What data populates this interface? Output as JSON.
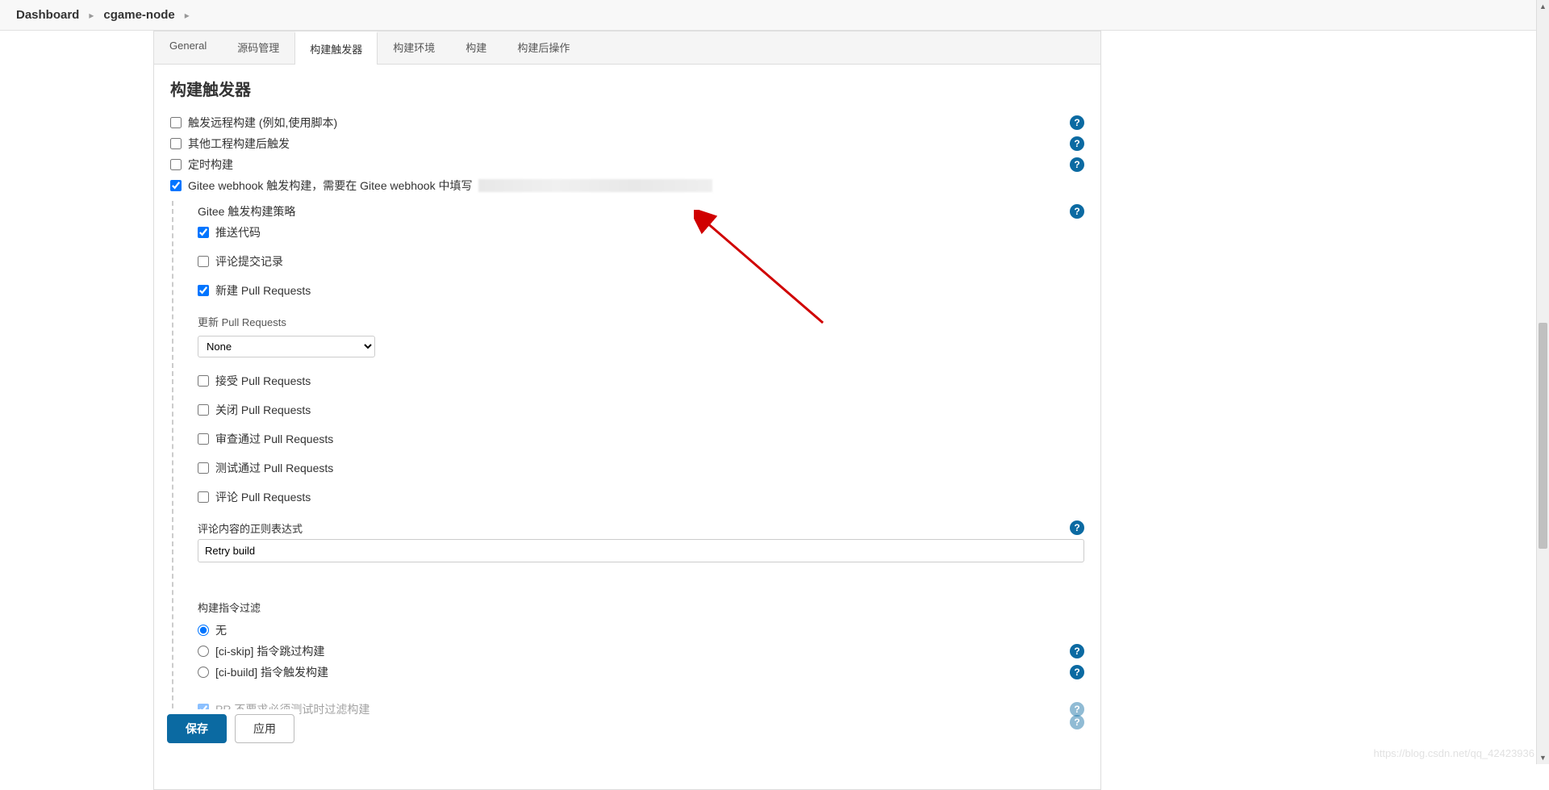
{
  "breadcrumb": {
    "item1": "Dashboard",
    "item2": "cgame-node"
  },
  "tabs": {
    "general": "General",
    "scm": "源码管理",
    "triggers": "构建触发器",
    "env": "构建环境",
    "build": "构建",
    "post": "构建后操作"
  },
  "section": {
    "title": "构建触发器"
  },
  "triggers": {
    "remote": {
      "label": "触发远程构建 (例如,使用脚本)",
      "checked": false
    },
    "after_other": {
      "label": "其他工程构建后触发",
      "checked": false
    },
    "timed": {
      "label": "定时构建",
      "checked": false
    },
    "gitee_webhook": {
      "label": "Gitee webhook 触发构建，需要在 Gitee webhook 中填写",
      "checked": true
    }
  },
  "gitee": {
    "strategy_label": "Gitee 触发构建策略",
    "push_code": {
      "label": "推送代码",
      "checked": true
    },
    "comment_commit": {
      "label": "评论提交记录",
      "checked": false
    },
    "new_pr": {
      "label": "新建 Pull Requests",
      "checked": true
    },
    "update_pr_label": "更新 Pull Requests",
    "update_pr_select": {
      "value": "None",
      "options": [
        "None"
      ]
    },
    "accept_pr": {
      "label": "接受 Pull Requests",
      "checked": false
    },
    "close_pr": {
      "label": "关闭 Pull Requests",
      "checked": false
    },
    "approve_pr": {
      "label": "审查通过 Pull Requests",
      "checked": false
    },
    "test_pass_pr": {
      "label": "测试通过 Pull Requests",
      "checked": false
    },
    "comment_pr": {
      "label": "评论 Pull Requests",
      "checked": false
    },
    "regex_label": "评论内容的正则表达式",
    "regex_value": "Retry build",
    "filter_label": "构建指令过滤",
    "filter_none": {
      "label": "无",
      "checked": true
    },
    "filter_ciskip": {
      "label": "[ci-skip] 指令跳过构建",
      "checked": false
    },
    "filter_cibuild": {
      "label": "[ci-build] 指令触发构建",
      "checked": false
    },
    "pr_no_test": {
      "label": "PR 不要求必须测试时过滤构建",
      "checked": true
    }
  },
  "buttons": {
    "save": "保存",
    "apply": "应用"
  },
  "watermark": "https://blog.csdn.net/qq_42423936"
}
